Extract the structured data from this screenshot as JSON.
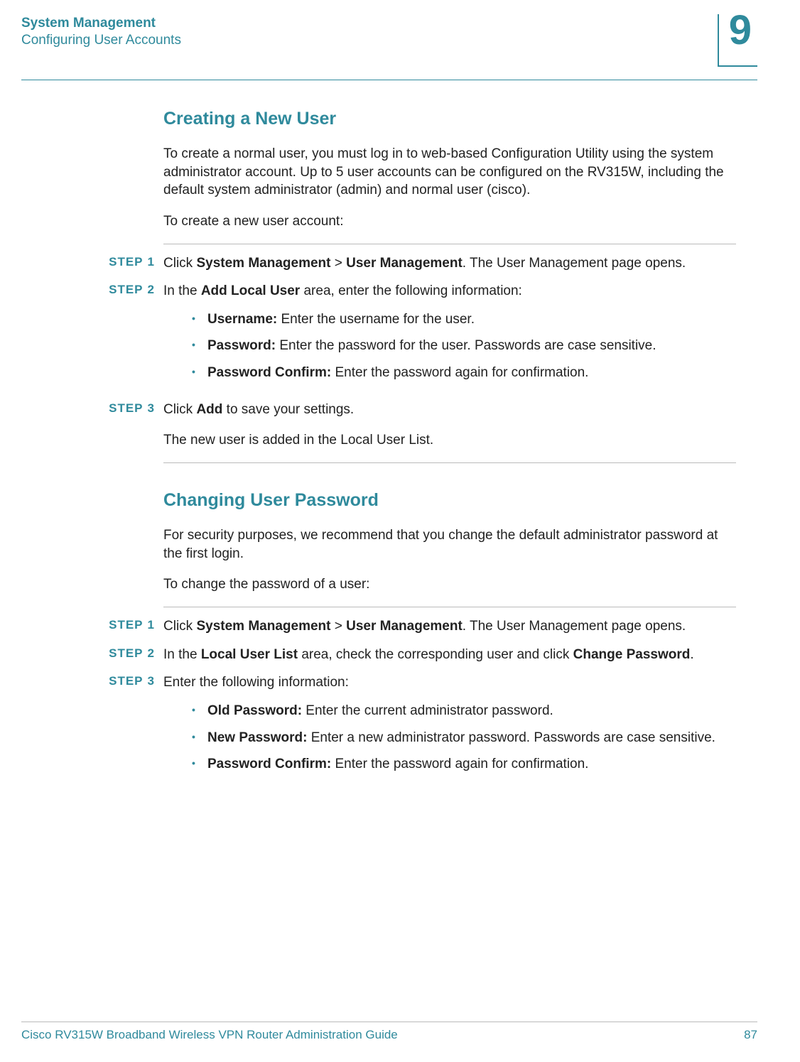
{
  "header": {
    "chapter_title": "System Management",
    "section_subtitle": "Configuring User Accounts",
    "chapter_number": "9"
  },
  "section1": {
    "heading": "Creating a New User",
    "intro1": "To create a normal user, you must log in to web-based Configuration Utility using the system administrator account. Up to 5 user accounts can be configured on the RV315W, including the default system administrator (admin) and normal user (cisco).",
    "intro2": "To create a new user account:",
    "step_word": "STEP",
    "steps": {
      "s1_num": "1",
      "s1_pre": "Click ",
      "s1_b1": "System Management",
      "s1_mid": " > ",
      "s1_b2": "User Management",
      "s1_post": ". The User Management page opens.",
      "s2_num": "2",
      "s2_pre": "In the ",
      "s2_b1": "Add Local User",
      "s2_post": " area, enter the following information:",
      "s2_b_user_label": "Username:",
      "s2_b_user_text": " Enter the username for the user.",
      "s2_b_pass_label": "Password:",
      "s2_b_pass_text": " Enter the password for the user. Passwords are case sensitive.",
      "s2_b_conf_label": "Password Confirm:",
      "s2_b_conf_text": " Enter the password again for confirmation.",
      "s3_num": "3",
      "s3_pre": "Click ",
      "s3_b1": "Add",
      "s3_post": " to save your settings.",
      "s3_note": "The new user is added in the Local User List."
    }
  },
  "section2": {
    "heading": "Changing User Password",
    "intro1": "For security purposes, we recommend that you change the default administrator password at the first login.",
    "intro2": "To change the password of a user:",
    "steps": {
      "s1_num": "1",
      "s1_pre": "Click ",
      "s1_b1": "System Management",
      "s1_mid": " > ",
      "s1_b2": "User Management",
      "s1_post": ". The User Management page opens.",
      "s2_num": "2",
      "s2_pre": "In the ",
      "s2_b1": "Local User List",
      "s2_mid": " area, check the corresponding user and click ",
      "s2_b2": "Change Password",
      "s2_post": ".",
      "s3_num": "3",
      "s3_text": "Enter the following information:",
      "s3_b_old_label": "Old Password:",
      "s3_b_old_text": " Enter the current administrator password.",
      "s3_b_new_label": "New Password:",
      "s3_b_new_text": " Enter a new administrator password. Passwords are case sensitive.",
      "s3_b_conf_label": "Password Confirm:",
      "s3_b_conf_text": " Enter the password again for confirmation."
    }
  },
  "footer": {
    "guide_title": "Cisco RV315W Broadband Wireless VPN Router Administration Guide",
    "page_number": "87"
  },
  "bullet_glyph": "•"
}
